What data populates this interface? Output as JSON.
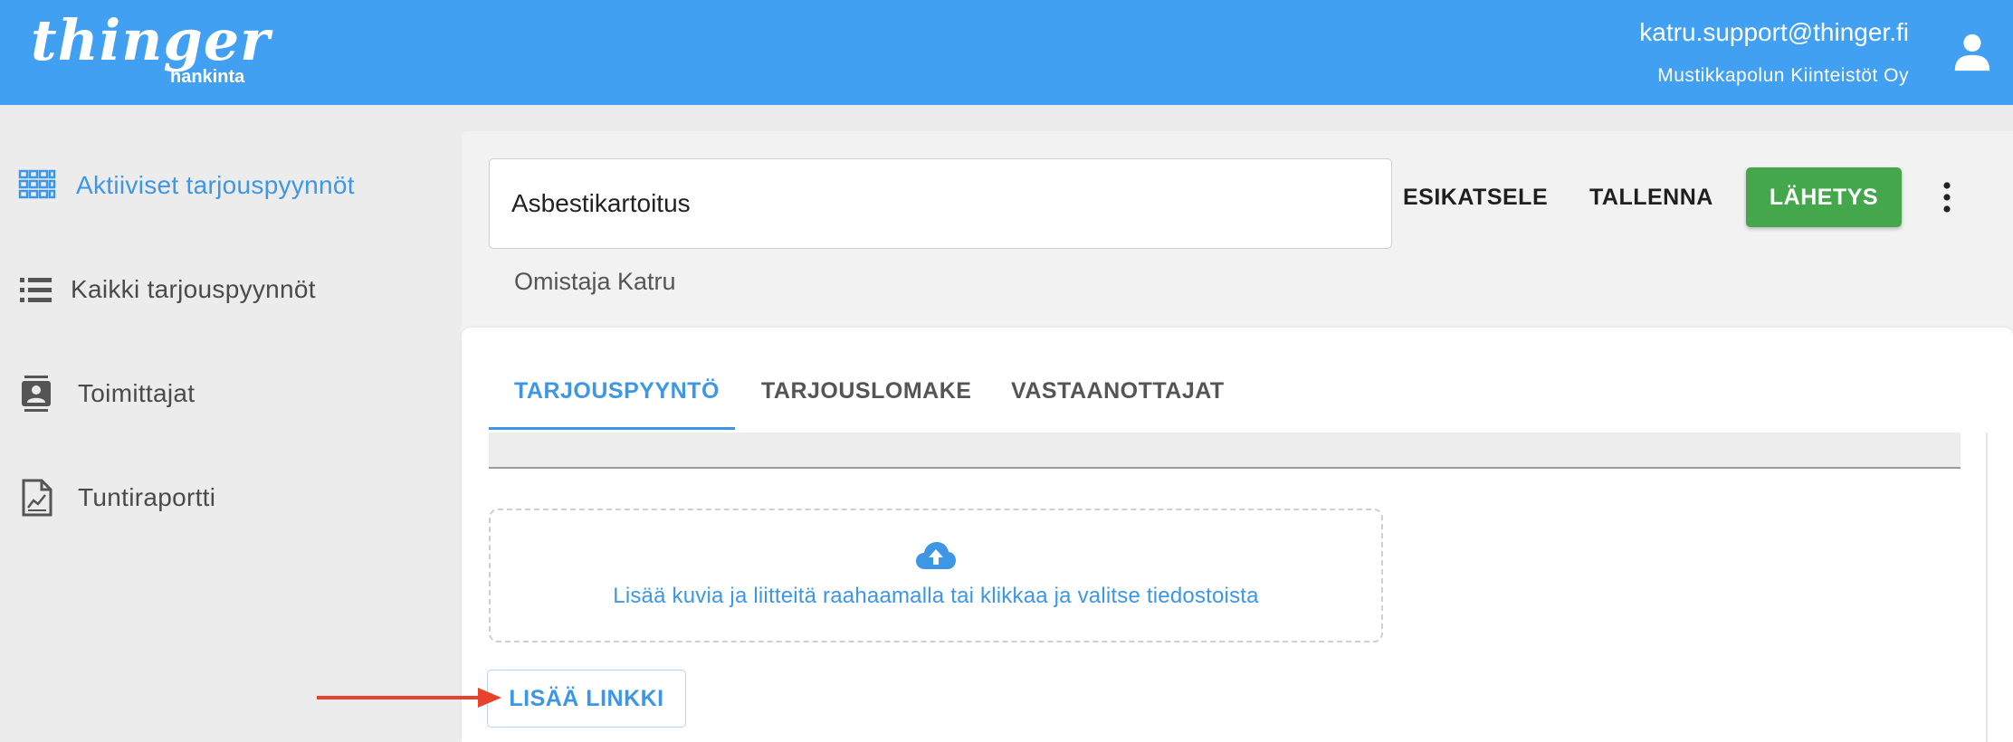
{
  "header": {
    "logo": "thinger",
    "logo_sub": "hankinta",
    "user_email": "katru.support@thinger.fi",
    "user_org": "Mustikkapolun Kiinteistöt Oy",
    "user_icon": "account-icon"
  },
  "sidebar": {
    "items": [
      {
        "label": "Aktiiviset tarjouspyynnöt",
        "icon": "grid-icon",
        "active": true
      },
      {
        "label": "Kaikki tarjouspyynnöt",
        "icon": "list-icon",
        "active": false
      },
      {
        "label": "Toimittajat",
        "icon": "contacts-icon",
        "active": false
      },
      {
        "label": "Tuntiraportti",
        "icon": "report-icon",
        "active": false
      }
    ]
  },
  "toolbar": {
    "title_value": "Asbestikartoitus",
    "preview_label": "ESIKATSELE",
    "save_label": "TALLENNA",
    "send_label": "LÄHETYS",
    "more_icon": "more-vertical-icon"
  },
  "owner": "Omistaja Katru",
  "tabs": [
    {
      "label": "TARJOUSPYYNTÖ",
      "active": true
    },
    {
      "label": "TARJOUSLOMAKE",
      "active": false
    },
    {
      "label": "VASTAANOTTAJAT",
      "active": false
    }
  ],
  "upload": {
    "icon": "cloud-upload-icon",
    "text": "Lisää kuvia ja liitteitä raahaamalla tai klikkaa ja valitse tiedostoista"
  },
  "add_link_label": "LISÄÄ LINKKI",
  "colors": {
    "header_bg": "#42a0f2",
    "accent": "#3d96e6",
    "send_button": "#45a74b",
    "annotation_arrow": "#e8412c"
  }
}
